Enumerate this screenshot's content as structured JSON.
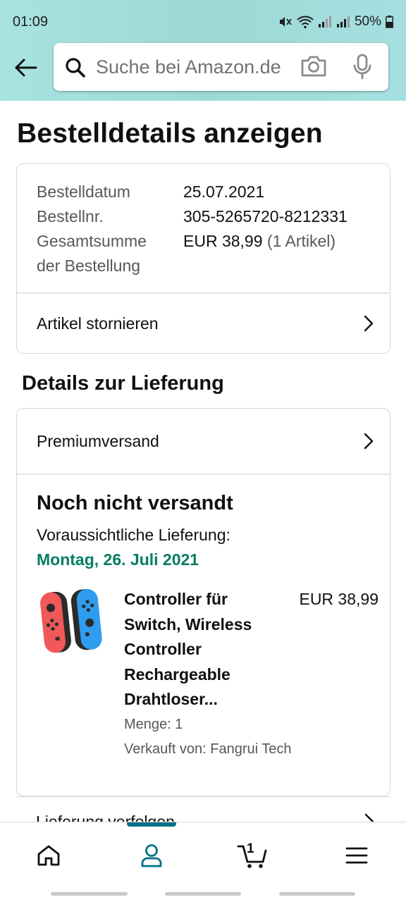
{
  "status_bar": {
    "time": "01:09",
    "battery": "50%"
  },
  "header": {
    "search": {
      "placeholder": "Suche bei Amazon.de"
    }
  },
  "page": {
    "title": "Bestelldetails anzeigen"
  },
  "order_summary": {
    "rows": [
      {
        "label": "Bestelldatum",
        "value": "25.07.2021"
      },
      {
        "label": "Bestellnr.",
        "value": "305-5265720-8212331"
      }
    ],
    "total_label_line1": "Gesamtsumme",
    "total_label_line2": "der Bestellung",
    "total_value": "EUR 38,99",
    "total_items": "(1 Artikel)",
    "cancel_link": "Artikel stornieren"
  },
  "delivery": {
    "section_title": "Details zur Lieferung",
    "shipping_method": "Premiumversand",
    "status": "Noch nicht versandt",
    "estimate_label": "Voraussichtliche Lieferung:",
    "estimate_date": "Montag, 26. Juli 2021",
    "estimate_color": "#067d62",
    "item": {
      "title_lines": [
        "Controller für",
        "Switch, Wireless",
        "Controller",
        "Rechargeable",
        "Drahtloser..."
      ],
      "price": "EUR 38,99",
      "quantity": "Menge: 1",
      "seller": "Verkauft von: Fangrui Tech"
    },
    "next_link_partial": "Lieferung verfolgen"
  },
  "bottom_nav": {
    "items": [
      "home-icon",
      "account-icon",
      "cart-icon",
      "menu-icon"
    ],
    "active": "account-icon",
    "cart_count": "1",
    "accent_color": "#007185"
  }
}
